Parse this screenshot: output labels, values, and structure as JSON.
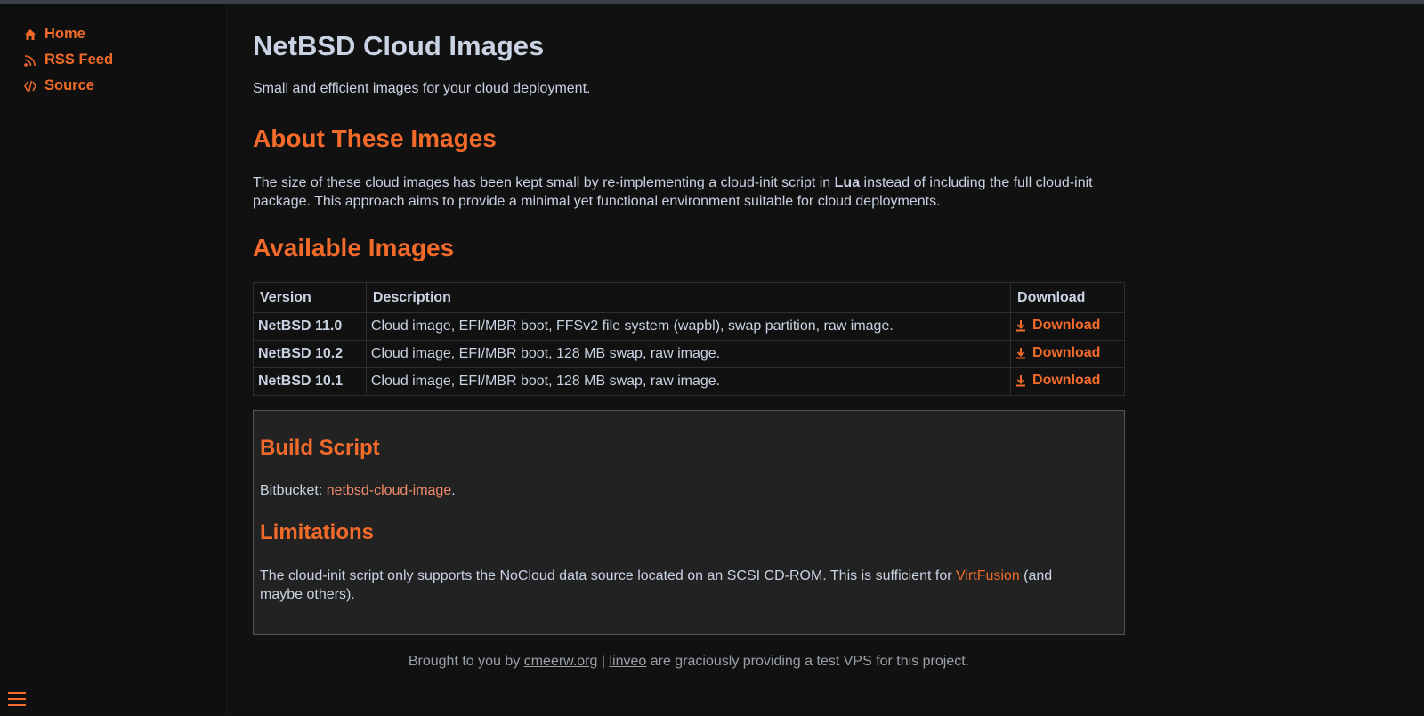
{
  "colors": {
    "accent": "#f26b2a",
    "text": "#c9d3e3",
    "background": "#111111",
    "panel": "#222222"
  },
  "nav": [
    {
      "label": "Home",
      "icon": "home-icon"
    },
    {
      "label": "RSS Feed",
      "icon": "rss-icon"
    },
    {
      "label": "Source",
      "icon": "code-icon"
    }
  ],
  "page": {
    "title": "NetBSD Cloud Images",
    "subtitle": "Small and efficient images for your cloud deployment."
  },
  "about": {
    "heading": "About These Images",
    "text_before": "The size of these cloud images has been kept small by re-implementing a cloud-init script in ",
    "bold": "Lua",
    "text_after": " instead of including the full cloud-init package. This approach aims to provide a minimal yet functional environment suitable for cloud deployments."
  },
  "available": {
    "heading": "Available Images",
    "columns": [
      "Version",
      "Description",
      "Download"
    ],
    "rows": [
      {
        "version": "NetBSD 11.0",
        "description": "Cloud image, EFI/MBR boot, FFSv2 file system (wapbl), swap partition, raw image.",
        "download": "Download"
      },
      {
        "version": "NetBSD 10.2",
        "description": "Cloud image, EFI/MBR boot, 128 MB swap, raw image.",
        "download": "Download"
      },
      {
        "version": "NetBSD 10.1",
        "description": "Cloud image, EFI/MBR boot, 128 MB swap, raw image.",
        "download": "Download"
      }
    ]
  },
  "build": {
    "heading": "Build Script",
    "prefix": "Bitbucket: ",
    "link": "netbsd-cloud-image",
    "suffix": "."
  },
  "limitations": {
    "heading": "Limitations",
    "text_before": "The cloud-init script only supports the NoCloud data source located on an SCSI CD-ROM. This is sufficient for ",
    "link": "VirtFusion",
    "text_after": " (and maybe others)."
  },
  "footer": {
    "prefix": "Brought to you by ",
    "link1": "cmeerw.org",
    "separator": " | ",
    "link2": "linveo",
    "suffix": " are graciously providing a test VPS for this project."
  }
}
